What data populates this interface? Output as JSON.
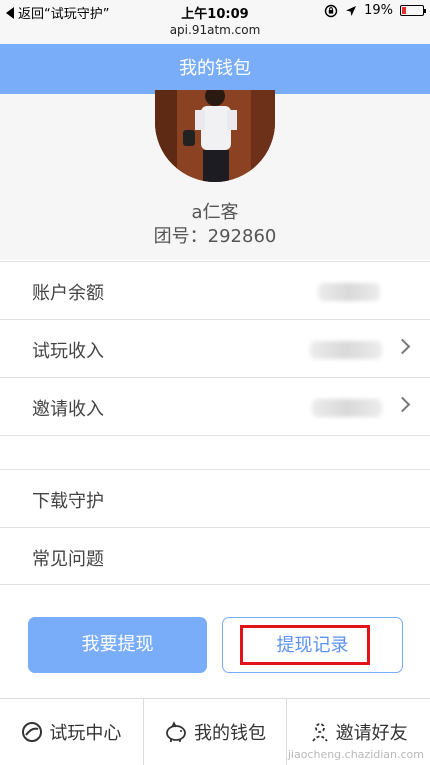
{
  "status_bar": {
    "back_label": "返回“试玩守护”",
    "time": "上午10:09",
    "url": "api.91atm.com",
    "battery": "19%"
  },
  "nav": {
    "title": "我的钱包"
  },
  "profile": {
    "username": "a仁客",
    "group_label": "团号：292860"
  },
  "rows": {
    "balance": "账户余额",
    "trial_income": "试玩收入",
    "invite_income": "邀请收入",
    "download": "下载守护",
    "faq": "常见问题"
  },
  "buttons": {
    "withdraw": "我要提现",
    "records": "提现记录"
  },
  "tabs": {
    "trial_center": "试玩中心",
    "wallet": "我的钱包",
    "invite": "邀请好友"
  },
  "watermark": "jiaocheng.chazidian.com",
  "colors": {
    "accent": "#7aadf9",
    "highlight": "#e1141a"
  }
}
